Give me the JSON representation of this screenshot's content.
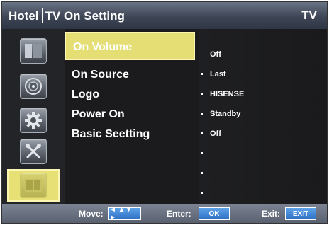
{
  "header": {
    "left_a": "Hotel",
    "left_b": "TV On Setting",
    "right": "TV"
  },
  "sidebar": {
    "icons": [
      {
        "name": "picture-icon"
      },
      {
        "name": "sound-icon"
      },
      {
        "name": "gear-icon"
      },
      {
        "name": "tools-icon"
      },
      {
        "name": "hotel-icon",
        "active": true
      }
    ]
  },
  "menu": {
    "items": [
      {
        "label": "On Volume",
        "selected": true
      },
      {
        "label": "On Source"
      },
      {
        "label": "Logo"
      },
      {
        "label": "Power On"
      },
      {
        "label": "Basic Seetting"
      }
    ]
  },
  "values": {
    "items": [
      {
        "text": "Off"
      },
      {
        "text": "Last"
      },
      {
        "text": "HISENSE"
      },
      {
        "text": "Standby"
      },
      {
        "text": "Off"
      },
      {
        "text": ""
      },
      {
        "text": ""
      },
      {
        "text": ""
      }
    ]
  },
  "footer": {
    "move_label": "Move:",
    "move_button": "◄ ▲▼ ►",
    "enter_label": "Enter:",
    "enter_button": "OK",
    "exit_label": "Exit:",
    "exit_button": "EXIT"
  },
  "colors": {
    "accent_yellow": "#e4de74",
    "header_bg": "#3e4656",
    "footer_bg": "#6b7382",
    "button_blue": "#3b84d6"
  }
}
